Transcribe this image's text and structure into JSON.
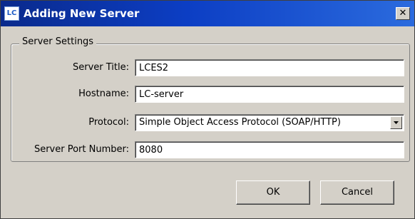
{
  "window": {
    "title": "Adding New Server",
    "app_icon_text": "LC",
    "close_glyph": "✕"
  },
  "group": {
    "label": "Server Settings"
  },
  "fields": {
    "server_title": {
      "label": "Server Title:",
      "value": "LCES2"
    },
    "hostname": {
      "label": "Hostname:",
      "value": "LC-server"
    },
    "protocol": {
      "label": "Protocol:",
      "value": "Simple Object Access Protocol (SOAP/HTTP)"
    },
    "port": {
      "label": "Server Port Number:",
      "value": "8080"
    }
  },
  "buttons": {
    "ok": "OK",
    "cancel": "Cancel"
  }
}
